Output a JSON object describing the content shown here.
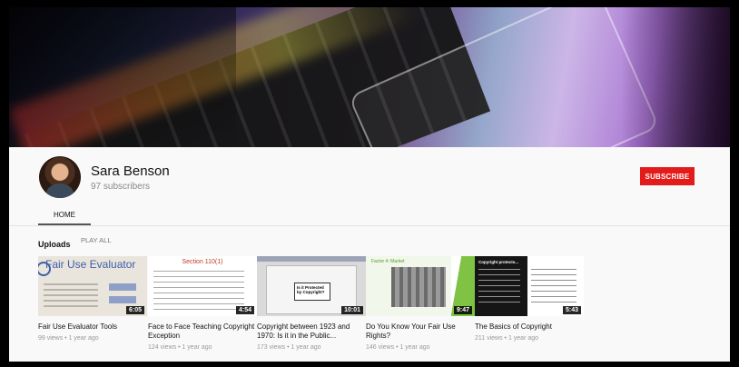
{
  "channel": {
    "name": "Sara Benson",
    "subscribers": "97 subscribers",
    "subscribe_label": "SUBSCRIBE"
  },
  "tabs": {
    "home": "HOME"
  },
  "uploads": {
    "title": "Uploads",
    "play_all": "PLAY ALL"
  },
  "videos": [
    {
      "title": "Fair Use Evaluator Tools",
      "meta": "99 views • 1 year ago",
      "duration": "6:05",
      "thumb_text": "Fair Use Evaluator"
    },
    {
      "title": "Face to Face Teaching Copyright Exception",
      "meta": "124 views • 1 year ago",
      "duration": "4:54",
      "thumb_text": "Section 110(1)"
    },
    {
      "title": "Copyright between 1923 and 1970: Is it in the Public...",
      "meta": "173 views • 1 year ago",
      "duration": "10:01",
      "thumb_text": "Is it Protected by Copyright?"
    },
    {
      "title": "Do You Know Your Fair Use Rights?",
      "meta": "146 views • 1 year ago",
      "duration": "9:47",
      "thumb_text": "Factor 4: Market"
    },
    {
      "title": "The Basics of Copyright",
      "meta": "211 views • 1 year ago",
      "duration": "5:43",
      "thumb_text": "Copyright protects..."
    }
  ],
  "colors": {
    "subscribe": "#e31b1b",
    "background": "#f9f9f9"
  }
}
